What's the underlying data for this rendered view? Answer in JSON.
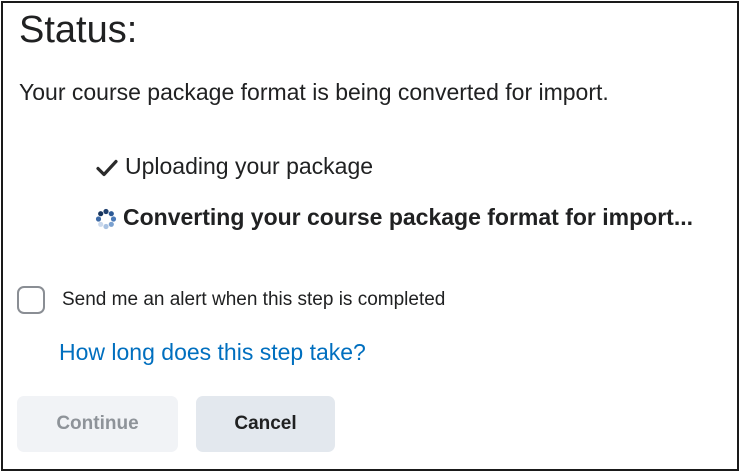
{
  "status": {
    "title": "Status:",
    "message": "Your course package format is being converted for import."
  },
  "steps": [
    {
      "label": "Uploading your package",
      "state": "complete",
      "icon": "check-icon"
    },
    {
      "label": "Converting your course package format for import...",
      "state": "in-progress",
      "icon": "spinner-icon"
    }
  ],
  "alert": {
    "label": "Send me an alert when this step is completed",
    "checked": false
  },
  "help_link": {
    "label": "How long does this step take?",
    "color": "#006fbf"
  },
  "buttons": {
    "continue_label": "Continue",
    "continue_disabled": true,
    "cancel_label": "Cancel"
  }
}
